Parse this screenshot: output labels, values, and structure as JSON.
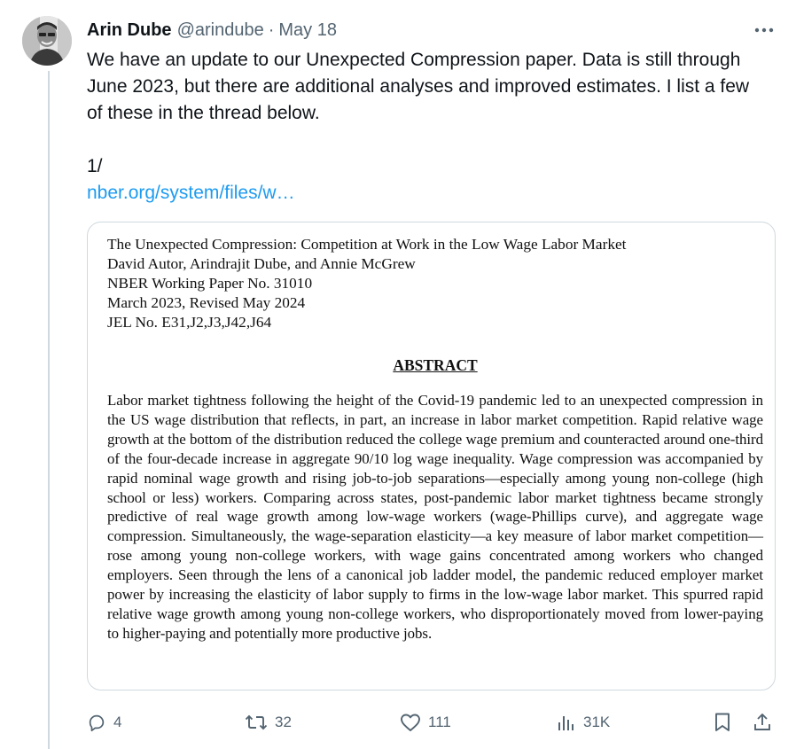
{
  "tweet": {
    "author_name": "Arin Dube",
    "handle": "@arindube",
    "separator": "·",
    "date": "May 18",
    "text_paragraph_1": "We have an update to our Unexpected Compression paper. Data is still through June 2023, but there are additional analyses and improved estimates. I list a few of these in the thread below.",
    "text_paragraph_2": "1/",
    "link_text": "nber.org/system/files/w…"
  },
  "card": {
    "paper_title": "The Unexpected Compression: Competition at Work in the Low Wage Labor Market",
    "authors": "David Autor, Arindrajit Dube, and Annie McGrew",
    "series": "NBER Working Paper No. 31010",
    "dates": "March 2023, Revised May 2024",
    "jel": "JEL No. E31,J2,J3,J42,J64",
    "abstract_heading": "ABSTRACT",
    "abstract_text": "Labor market tightness following the height of the Covid-19 pandemic led to an unexpected compression in the US wage distribution that reflects, in part, an increase in labor market competition. Rapid relative wage growth at the bottom of the distribution reduced the college wage premium and counteracted around one-third of the four-decade increase in aggregate 90/10 log wage inequality. Wage compression was accompanied by rapid nominal wage growth and rising job-to-job separations—especially among young non-college (high school or less) workers. Comparing across states, post-pandemic labor market tightness became strongly predictive of real wage growth among low-wage workers (wage-Phillips curve), and aggregate wage compression. Simultaneously, the wage-separation elasticity—a key measure of labor market competition—rose among young non-college workers, with wage gains concentrated among workers who changed employers. Seen through the lens of a canonical job ladder model, the pandemic reduced employer market power by increasing the elasticity of labor supply to firms in the low-wage labor market. This spurred rapid relative wage growth among young non-college workers, who disproportionately moved from lower-paying to higher-paying and potentially more productive jobs."
  },
  "actions": {
    "replies": "4",
    "reposts": "32",
    "likes": "111",
    "views": "31K"
  },
  "icons": {
    "more": "more-horizontal-icon",
    "reply": "reply-icon",
    "repost": "repost-icon",
    "like": "heart-icon",
    "views": "views-chart-icon",
    "bookmark": "bookmark-icon",
    "share": "share-icon"
  },
  "colors": {
    "text": "#0f1419",
    "secondary": "#536471",
    "link": "#1d9bf0",
    "border": "#cfd9de"
  }
}
